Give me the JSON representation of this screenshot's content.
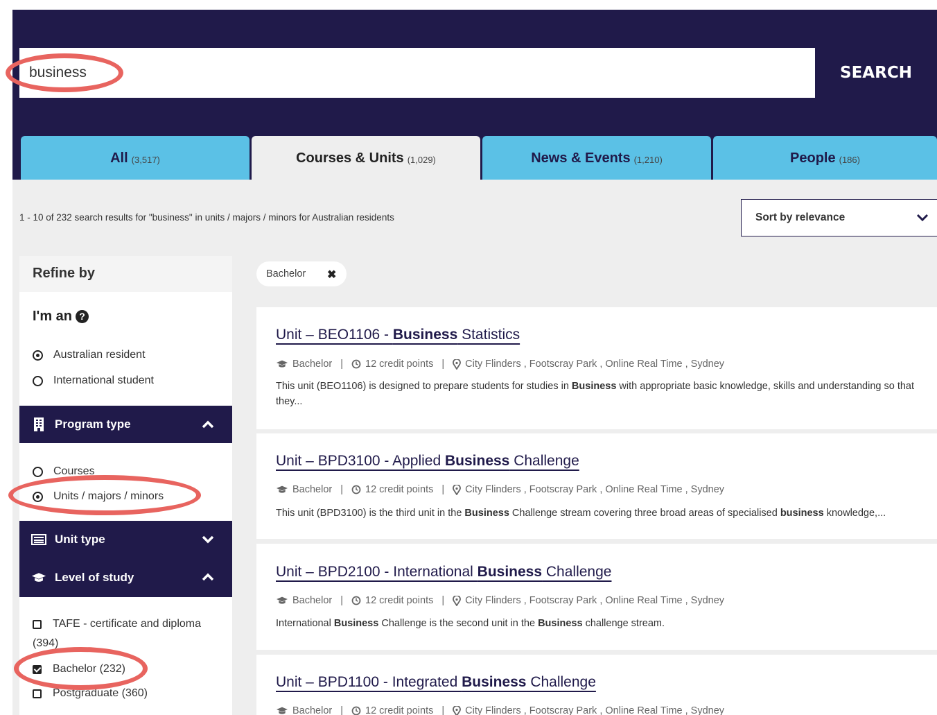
{
  "search": {
    "value": "business",
    "button_label": "SEARCH"
  },
  "tabs": [
    {
      "label": "All",
      "count": "(3,517)",
      "active": false
    },
    {
      "label": "Courses & Units",
      "count": "(1,029)",
      "active": true
    },
    {
      "label": "News & Events",
      "count": "(1,210)",
      "active": false
    },
    {
      "label": "People",
      "count": "(186)",
      "active": false
    }
  ],
  "results_summary": "1 - 10 of 232 search results for \"business\" in units / majors / minors for Australian residents",
  "sort": {
    "label": "Sort by relevance"
  },
  "sidebar": {
    "refine_title": "Refine by",
    "resident_question": "I'm an",
    "resident_options": [
      {
        "label": "Australian resident",
        "selected": true
      },
      {
        "label": "International student",
        "selected": false
      }
    ],
    "program_type": {
      "title": "Program type",
      "expanded": true,
      "options": [
        {
          "label": "Courses",
          "selected": false
        },
        {
          "label": "Units / majors / minors",
          "selected": true
        }
      ]
    },
    "unit_type": {
      "title": "Unit type",
      "expanded": false
    },
    "level_of_study": {
      "title": "Level of study",
      "expanded": true,
      "options": [
        {
          "label": "TAFE - certificate and diploma",
          "count": "(394)",
          "checked": false
        },
        {
          "label": "Bachelor (232)",
          "checked": true
        },
        {
          "label": "Postgraduate (360)",
          "checked": false
        }
      ]
    }
  },
  "active_filter": {
    "label": "Bachelor"
  },
  "results": [
    {
      "title_prefix": "Unit – BEO1106 - ",
      "title_bold": "Business",
      "title_suffix": " Statistics",
      "level": "Bachelor",
      "credits": "12 credit points",
      "locations": "City Flinders , Footscray Park , Online Real Time , Sydney",
      "desc_parts": [
        "This unit (BEO1106) is designed to prepare students for studies in ",
        "Business",
        " with appropriate basic knowledge, skills and understanding so that they..."
      ]
    },
    {
      "title_prefix": "Unit – BPD3100 - Applied ",
      "title_bold": "Business",
      "title_suffix": " Challenge",
      "level": "Bachelor",
      "credits": "12 credit points",
      "locations": "City Flinders , Footscray Park , Online Real Time , Sydney",
      "desc_parts": [
        "This unit (BPD3100) is the third unit in the ",
        "Business",
        " Challenge stream covering three broad areas of specialised ",
        "business",
        " knowledge,..."
      ]
    },
    {
      "title_prefix": "Unit – BPD2100 - International ",
      "title_bold": "Business",
      "title_suffix": " Challenge",
      "level": "Bachelor",
      "credits": "12 credit points",
      "locations": "City Flinders , Footscray Park , Online Real Time , Sydney",
      "desc_parts": [
        "International ",
        "Business",
        " Challenge is the second unit in the ",
        "Business",
        " challenge stream."
      ]
    },
    {
      "title_prefix": "Unit – BPD1100 - Integrated ",
      "title_bold": "Business",
      "title_suffix": " Challenge",
      "level": "Bachelor",
      "credits": "12 credit points",
      "locations": "City Flinders , Footscray Park , Online Real Time , Sydney"
    }
  ],
  "colors": {
    "navy": "#201a4a",
    "tab_blue": "#5bc1e6",
    "background": "#eeeeee",
    "highlight_ring": "#e8645f"
  }
}
